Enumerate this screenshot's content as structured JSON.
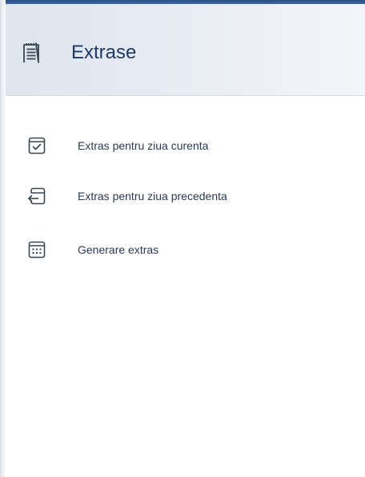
{
  "panel": {
    "title": "Extrase",
    "title_icon": "receipt-icon"
  },
  "menu": {
    "items": [
      {
        "label": "Extras pentru ziua curenta",
        "icon": "calendar-check-icon"
      },
      {
        "label": "Extras pentru ziua precedenta",
        "icon": "calendar-back-icon"
      },
      {
        "label": "Generare extras",
        "icon": "calendar-grid-icon"
      }
    ]
  },
  "colors": {
    "accent": "#2a4f86",
    "icon": "#37474f",
    "header_bg": "#e4e9f0",
    "text": "#2b3a55"
  }
}
